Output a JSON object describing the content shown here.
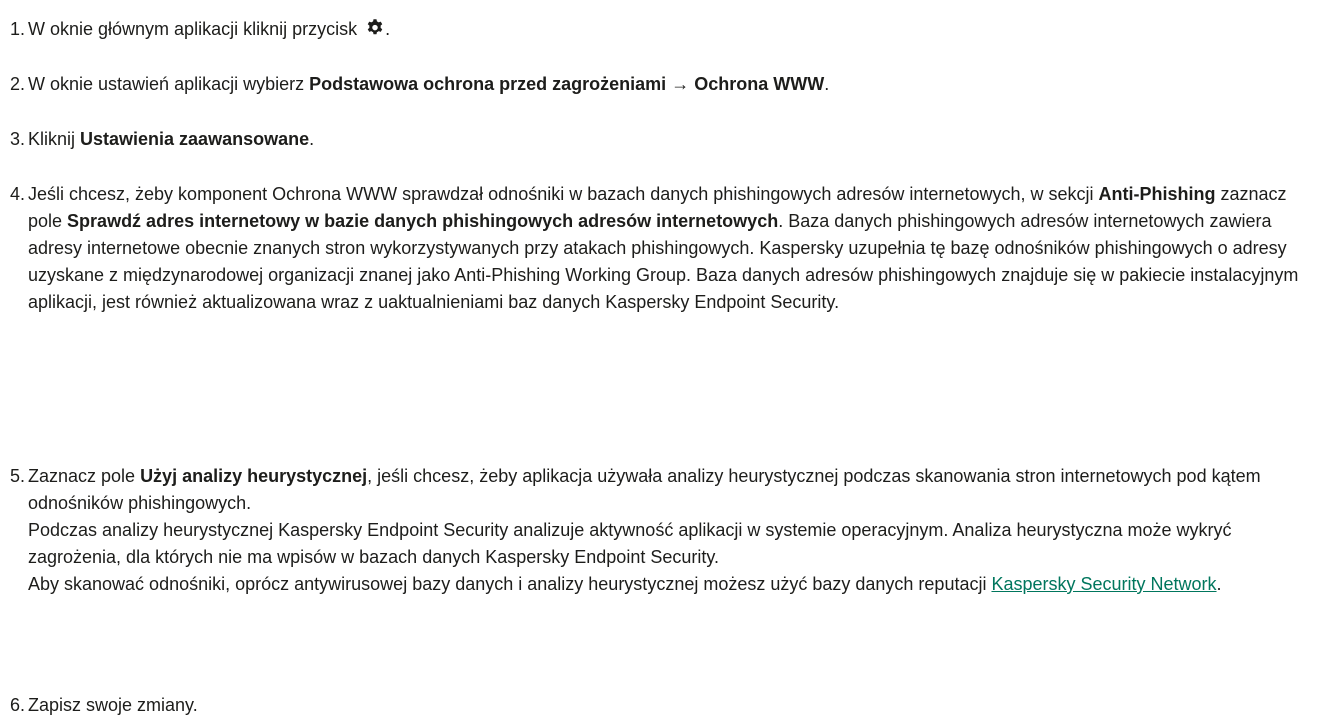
{
  "steps": [
    {
      "number": "1.",
      "text": "W oknie głównym aplikacji kliknij przycisk ",
      "icon": "gear-icon",
      "after": "."
    },
    {
      "number": "2.",
      "t1": "W oknie ustawień aplikacji wybierz ",
      "b1": "Podstawowa ochrona przed zagrożeniami",
      "t2": " → ",
      "b2": "Ochrona WWW",
      "t3": "."
    },
    {
      "number": "3.",
      "t1": "Kliknij ",
      "b1": "Ustawienia zaawansowane",
      "t2": "."
    },
    {
      "number": "4.",
      "t1": "Jeśli chcesz, żeby komponent Ochrona WWW sprawdzał odnośniki w bazach danych phishingowych adresów internetowych, w sekcji ",
      "b1": "Anti-Phishing",
      "t2": " zaznacz pole ",
      "b2": "Sprawdź adres internetowy w bazie danych phishingowych adresów internetowych",
      "t3": ". Baza danych phishingowych adresów internetowych zawiera adresy internetowe obecnie znanych stron wykorzystywanych przy atakach phishingowych. Kaspersky uzupełnia tę bazę odnośników phishingowych o adresy uzyskane z międzynarodowej organizacji znanej jako Anti-Phishing Working Group. Baza danych adresów phishingowych znajduje się w pakiecie instalacyjnym aplikacji, jest również aktualizowana wraz z uaktualnieniami baz danych Kaspersky Endpoint Security."
    },
    {
      "number": "5.",
      "t1": "Zaznacz pole ",
      "b1": "Użyj analizy heurystycznej",
      "t2": ", jeśli chcesz, żeby aplikacja używała analizy heurystycznej podczas skanowania stron internetowych pod kątem odnośników phishingowych.",
      "p2": "Podczas analizy heurystycznej Kaspersky Endpoint Security analizuje aktywność aplikacji w systemie operacyjnym. Analiza heurystyczna może wykryć zagrożenia, dla których nie ma wpisów w bazach danych Kaspersky Endpoint Security.",
      "p3": "Aby skanować odnośniki, oprócz antywirusowej bazy danych i analizy heurystycznej możesz użyć bazy danych reputacji ",
      "link": "Kaspersky Security Network",
      "p3_end": "."
    },
    {
      "number": "6.",
      "text": "Zapisz swoje zmiany."
    }
  ],
  "colors": {
    "text": "#1d1d1b",
    "link": "#00765d"
  }
}
